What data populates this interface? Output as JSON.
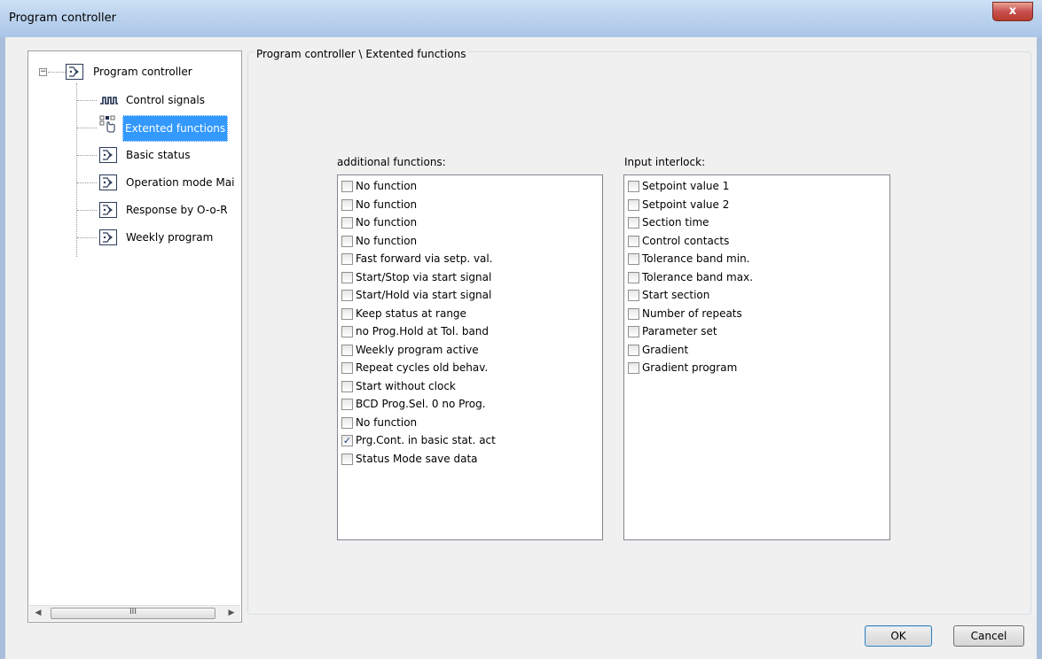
{
  "window": {
    "title": "Program controller",
    "close_label": "x"
  },
  "tree": {
    "root": {
      "label": "Program controller",
      "expander": "−"
    },
    "items": [
      {
        "label": "Control signals",
        "icon": "pulse-signal-icon",
        "selected": false
      },
      {
        "label": "Extented functions",
        "icon": "pointer-grid-icon",
        "selected": true
      },
      {
        "label": "Basic status",
        "icon": "program-flow-icon",
        "selected": false
      },
      {
        "label": "Operation mode Mai",
        "icon": "program-flow-icon",
        "selected": false
      },
      {
        "label": "Response by O-o-R",
        "icon": "program-flow-icon",
        "selected": false
      },
      {
        "label": "Weekly program",
        "icon": "program-flow-icon",
        "selected": false
      }
    ],
    "scroll_thumb_grip": "III"
  },
  "panel": {
    "breadcrumb": "Program controller \\ Extented functions",
    "additional_label": "additional functions:",
    "interlock_label": "Input interlock:",
    "additional_functions": [
      {
        "label": "No function",
        "checked": false
      },
      {
        "label": "No function",
        "checked": false
      },
      {
        "label": "No function",
        "checked": false
      },
      {
        "label": "No function",
        "checked": false
      },
      {
        "label": "Fast forward via setp. val.",
        "checked": false
      },
      {
        "label": "Start/Stop via start signal",
        "checked": false
      },
      {
        "label": "Start/Hold via start signal",
        "checked": false
      },
      {
        "label": "Keep status at range",
        "checked": false
      },
      {
        "label": "no Prog.Hold at Tol. band",
        "checked": false
      },
      {
        "label": "Weekly program active",
        "checked": false
      },
      {
        "label": "Repeat cycles old behav.",
        "checked": false
      },
      {
        "label": "Start without clock",
        "checked": false
      },
      {
        "label": "BCD Prog.Sel. 0 no Prog.",
        "checked": false
      },
      {
        "label": "No function",
        "checked": false
      },
      {
        "label": "Prg.Cont. in basic stat. act",
        "checked": true
      },
      {
        "label": "Status Mode save data",
        "checked": false
      }
    ],
    "input_interlock": [
      {
        "label": "Setpoint value 1",
        "checked": false
      },
      {
        "label": "Setpoint value 2",
        "checked": false
      },
      {
        "label": "Section time",
        "checked": false
      },
      {
        "label": "Control contacts",
        "checked": false
      },
      {
        "label": "Tolerance band min.",
        "checked": false
      },
      {
        "label": "Tolerance band max.",
        "checked": false
      },
      {
        "label": "Start section",
        "checked": false
      },
      {
        "label": "Number of repeats",
        "checked": false
      },
      {
        "label": "Parameter set",
        "checked": false
      },
      {
        "label": "Gradient",
        "checked": false
      },
      {
        "label": "Gradient program",
        "checked": false
      }
    ]
  },
  "buttons": {
    "ok": "OK",
    "cancel": "Cancel"
  },
  "check_glyph": "✓"
}
